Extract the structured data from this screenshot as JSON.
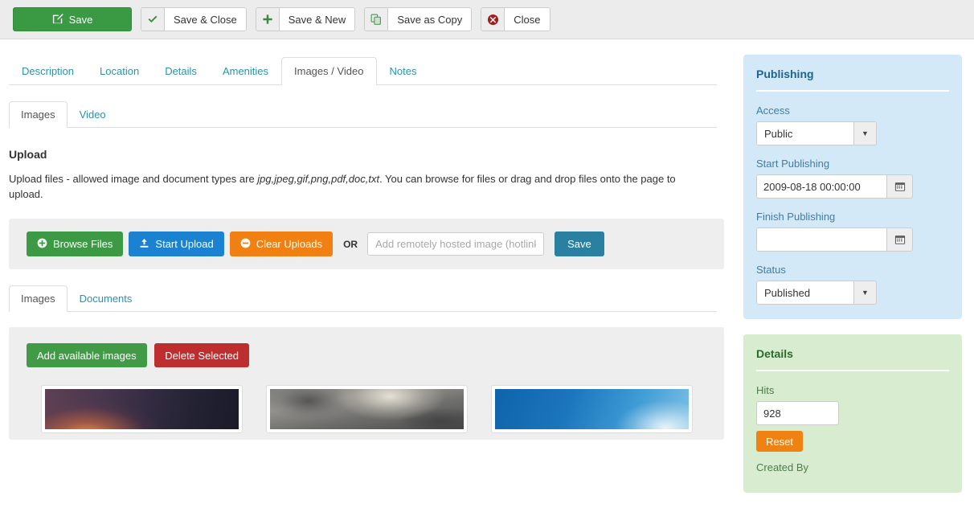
{
  "toolbar": {
    "save": {
      "label": "Save",
      "icon": "save-pencil-icon"
    },
    "save_close": {
      "label": "Save & Close",
      "icon": "check-icon"
    },
    "save_new": {
      "label": "Save & New",
      "icon": "plus-icon"
    },
    "save_copy": {
      "label": "Save as Copy",
      "icon": "copy-icon"
    },
    "close": {
      "label": "Close",
      "icon": "close-circle-icon"
    }
  },
  "tabs_primary": [
    {
      "label": "Description",
      "active": false
    },
    {
      "label": "Location",
      "active": false
    },
    {
      "label": "Details",
      "active": false
    },
    {
      "label": "Amenities",
      "active": false
    },
    {
      "label": "Images / Video",
      "active": true
    },
    {
      "label": "Notes",
      "active": false
    }
  ],
  "tabs_secondary": [
    {
      "label": "Images",
      "active": true
    },
    {
      "label": "Video",
      "active": false
    }
  ],
  "upload": {
    "title": "Upload",
    "description_pre": "Upload files - allowed image and document types are ",
    "description_types": "jpg,jpeg,gif,png,pdf,doc,txt",
    "description_post": ". You can browse for files or drag and drop files onto the page to upload.",
    "browse_label": "Browse Files",
    "start_label": "Start Upload",
    "clear_label": "Clear Uploads",
    "or_label": "OR",
    "hotlink_placeholder": "Add remotely hosted image (hotlink)",
    "hotlink_value": "",
    "save_label": "Save"
  },
  "gallery": {
    "tabs": [
      {
        "label": "Images",
        "active": true
      },
      {
        "label": "Documents",
        "active": false
      }
    ],
    "add_label": "Add available images",
    "delete_label": "Delete Selected",
    "thumbnails": [
      {
        "name": "sunset-thumbnail",
        "style": "img-sunset"
      },
      {
        "name": "storm-clouds-thumbnail",
        "style": "img-clouds"
      },
      {
        "name": "blue-sky-thumbnail",
        "style": "img-sky"
      }
    ]
  },
  "sidebar": {
    "publishing": {
      "title": "Publishing",
      "access_label": "Access",
      "access_value": "Public",
      "start_label": "Start Publishing",
      "start_value": "2009-08-18 00:00:00",
      "finish_label": "Finish Publishing",
      "finish_value": "",
      "status_label": "Status",
      "status_value": "Published"
    },
    "details": {
      "title": "Details",
      "hits_label": "Hits",
      "hits_value": "928",
      "reset_label": "Reset",
      "created_by_label": "Created By"
    }
  },
  "colors": {
    "primary_green": "#3a9a43",
    "blue": "#1a82d1",
    "orange": "#f08012",
    "teal": "#2980a0",
    "red": "#bf2e2e",
    "tab_link": "#2b92aa",
    "publishing_bg": "#d4e9f7",
    "details_bg": "#d8ecd0"
  }
}
